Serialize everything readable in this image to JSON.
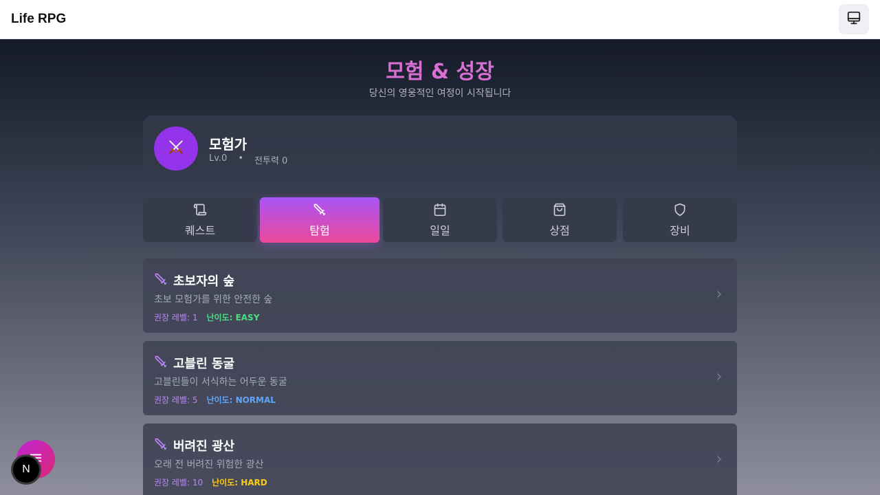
{
  "app": {
    "title": "Life RPG",
    "monitor_icon": "monitor-icon"
  },
  "page": {
    "title": "모험 & 성장",
    "subtitle": "당신의 영웅적인 여정이 시작됩니다"
  },
  "profile": {
    "name": "모험가",
    "level": "Lv.0",
    "separator": "•",
    "power": "전투력 0",
    "avatar_icon": "crossed-swords-icon"
  },
  "tabs": [
    {
      "label": "퀘스트",
      "icon": "scroll-icon",
      "active": false
    },
    {
      "label": "탐험",
      "icon": "sword-icon",
      "active": true
    },
    {
      "label": "일일",
      "icon": "calendar-icon",
      "active": false
    },
    {
      "label": "상점",
      "icon": "shopping-bag-icon",
      "active": false
    },
    {
      "label": "장비",
      "icon": "shield-icon",
      "active": false
    }
  ],
  "dungeons": [
    {
      "title": "초보자의 숲",
      "description": "초보 모험가를 위한 안전한 숲",
      "recommended": "권장 레벨: 1",
      "difficulty": "난이도: EASY",
      "difficulty_color": "#4ade80"
    },
    {
      "title": "고블린 동굴",
      "description": "고블린들이 서식하는 어두운 동굴",
      "recommended": "권장 레벨: 5",
      "difficulty": "난이도: NORMAL",
      "difficulty_color": "#60a5fa"
    },
    {
      "title": "버려진 광산",
      "description": "오래 전 버려진 위험한 광산",
      "recommended": "권장 레벨: 10",
      "difficulty": "난이도: HARD",
      "difficulty_color": "#facc15"
    }
  ],
  "colors": {
    "accent": "#a855f7",
    "accent2": "#ec4899",
    "title": "#d96fd3"
  },
  "fab": {
    "icon": "menu-icon"
  },
  "badge": {
    "label": "N"
  }
}
